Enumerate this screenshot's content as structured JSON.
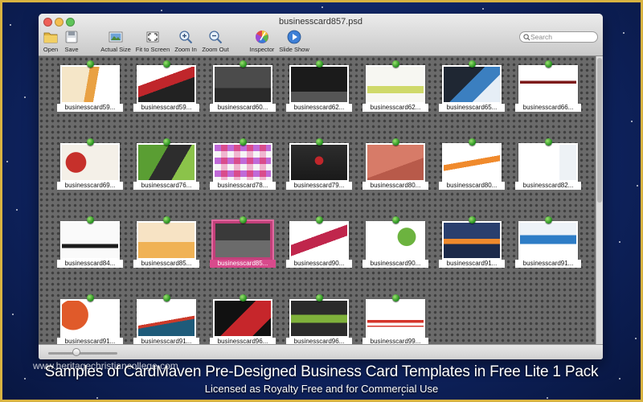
{
  "window": {
    "title": "businesscard857.psd"
  },
  "toolbar": {
    "open": "Open",
    "save": "Save",
    "actual_size": "Actual Size",
    "fit_to_screen": "Fit to Screen",
    "zoom_in": "Zoom In",
    "zoom_out": "Zoom Out",
    "inspector": "Inspector",
    "slide_show": "Slide Show"
  },
  "search": {
    "placeholder": "Search"
  },
  "thumbnails": [
    {
      "label": "businesscard59...",
      "art": "orange-beige"
    },
    {
      "label": "businesscard59...",
      "art": "red-swoosh"
    },
    {
      "label": "businesscard60...",
      "art": "dark-gray"
    },
    {
      "label": "businesscard62...",
      "art": "black-stripe"
    },
    {
      "label": "businesscard62...",
      "art": "white-green"
    },
    {
      "label": "businesscard65...",
      "art": "blue-diagonal"
    },
    {
      "label": "businesscard66...",
      "art": "white-maroon"
    },
    {
      "label": "businesscard69...",
      "art": "red-apple"
    },
    {
      "label": "businesscard76...",
      "art": "green-diagonal"
    },
    {
      "label": "businesscard78...",
      "art": "mosaic"
    },
    {
      "label": "businesscard79...",
      "art": "dark-red-logo"
    },
    {
      "label": "businesscard80...",
      "art": "salmon"
    },
    {
      "label": "businesscard80...",
      "art": "white-orange-wave"
    },
    {
      "label": "businesscard82...",
      "art": "white-blue-logo"
    },
    {
      "label": "businesscard84...",
      "art": "white-gold"
    },
    {
      "label": "businesscard85...",
      "art": "peach"
    },
    {
      "label": "businesscard85...",
      "art": "dark-selected"
    },
    {
      "label": "businesscard90...",
      "art": "feather"
    },
    {
      "label": "businesscard90...",
      "art": "tree"
    },
    {
      "label": "businesscard91...",
      "art": "sunset"
    },
    {
      "label": "businesscard91...",
      "art": "blue-ribbon"
    },
    {
      "label": "businesscard91...",
      "art": "orange-circle"
    },
    {
      "label": "businesscard91...",
      "art": "white-teal-wave"
    },
    {
      "label": "businesscard96...",
      "art": "red-black-diagonal"
    },
    {
      "label": "businesscard96...",
      "art": "green-dark"
    },
    {
      "label": "businesscard99...",
      "art": "red-lines"
    }
  ],
  "selected_index": 16,
  "colors": {
    "accent_selected": "#d84a8c",
    "pin_green": "#1e8a19",
    "frame_gold": "#d8b341"
  },
  "caption": {
    "watermark": "www.heritagechristiancollege.com",
    "line1": "Samples of CardMaven Pre-Designed Business Card  Templates in Free Lite 1 Pack",
    "line2": "Licensed as Royalty Free and for Commercial Use"
  }
}
